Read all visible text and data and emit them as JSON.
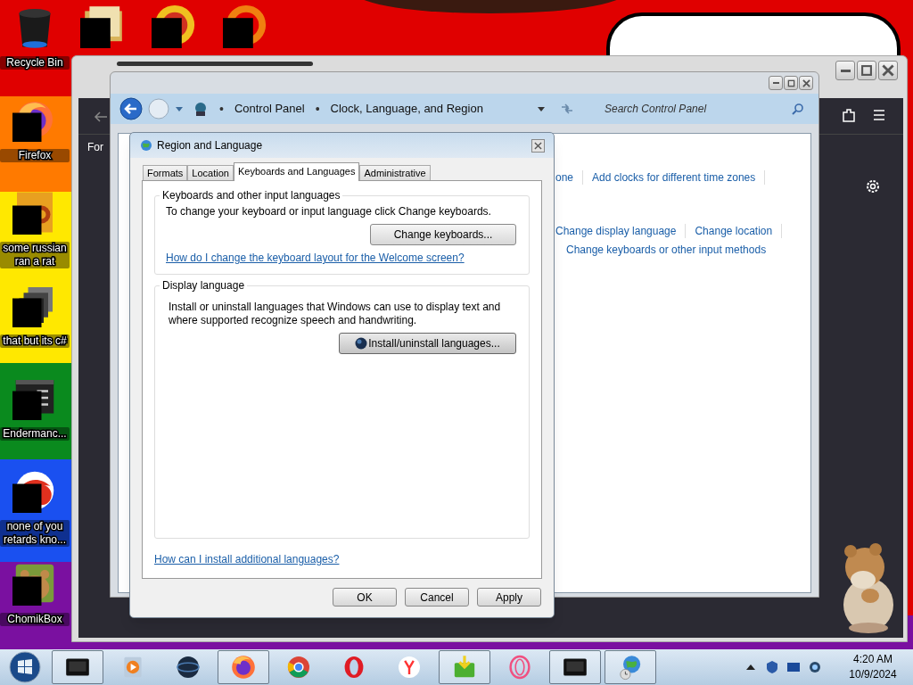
{
  "desktop_icons": [
    {
      "label": "Recycle Bin",
      "kind": "bin",
      "censored": false
    },
    {
      "label": "Firefox",
      "kind": "firefox",
      "censored": true
    },
    {
      "label": "some russian ran a rat",
      "kind": "document",
      "censored": true
    },
    {
      "label": "that but its c#",
      "kind": "stack",
      "censored": true
    },
    {
      "label": "Endermanc...",
      "kind": "terminal",
      "censored": true
    },
    {
      "label": "none of you retards kno...",
      "kind": "redball",
      "censored": true
    },
    {
      "label": "ChomikBox",
      "kind": "hamster",
      "censored": true
    }
  ],
  "top_icons": [
    {
      "kind": "folder",
      "censored": true
    },
    {
      "kind": "orb",
      "censored": true
    },
    {
      "kind": "ring",
      "censored": true
    }
  ],
  "browser_window": {
    "partial_text": "For"
  },
  "control_panel": {
    "breadcrumb": [
      {
        "separator": "•",
        "label": "Control Panel"
      },
      {
        "separator": "•",
        "label": "Clock, Language, and Region"
      }
    ],
    "search": {
      "placeholder": "Search Control Panel"
    },
    "link_rows": [
      [
        "one",
        "Add clocks for different time zones"
      ],
      [
        "Change display language",
        "Change location"
      ],
      [
        "Change keyboards or other input methods"
      ]
    ]
  },
  "dialog": {
    "title": "Region and Language",
    "tabs": [
      {
        "label": "Formats",
        "selected": false
      },
      {
        "label": "Location",
        "selected": false
      },
      {
        "label": "Keyboards and Languages",
        "selected": true
      },
      {
        "label": "Administrative",
        "selected": false
      }
    ],
    "keyboards_group": {
      "title": "Keyboards and other input languages",
      "text": "To change your keyboard or input language click Change keyboards.",
      "button": "Change keyboards...",
      "link": "How do I change the keyboard layout for the Welcome screen?"
    },
    "display_group": {
      "title": "Display language",
      "text": "Install or uninstall languages that Windows can use to display text and where supported recognize speech and handwriting.",
      "button": "Install/uninstall languages..."
    },
    "footer_link": "How can I install additional languages?",
    "buttons": [
      "OK",
      "Cancel",
      "Apply"
    ]
  },
  "taskbar": {
    "apps": [
      {
        "kind": "darkwindow",
        "running": true
      },
      {
        "kind": "media",
        "running": false
      },
      {
        "kind": "darkglobe",
        "running": false
      },
      {
        "kind": "firefox",
        "running": true
      },
      {
        "kind": "chrome",
        "running": false
      },
      {
        "kind": "opera",
        "running": false
      },
      {
        "kind": "yandex",
        "running": false
      },
      {
        "kind": "installer",
        "running": true
      },
      {
        "kind": "operagx",
        "running": false
      },
      {
        "kind": "darkwindow",
        "running": true
      },
      {
        "kind": "globe",
        "running": true
      }
    ],
    "time": "4:20 AM",
    "date": "10/9/2024"
  }
}
